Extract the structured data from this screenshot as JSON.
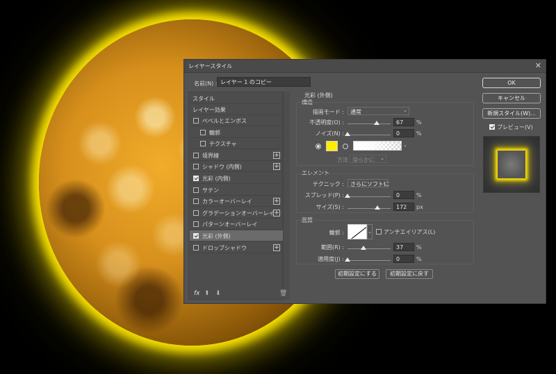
{
  "dialog": {
    "title": "レイヤースタイル",
    "close_glyph": "✕"
  },
  "name": {
    "label": "名前(N) :",
    "value": "レイヤー 1 のコピー"
  },
  "style_list": {
    "header_styles": "スタイル",
    "header_effects": "レイヤー効果",
    "items": [
      {
        "label": "ベベルとエンボス",
        "checked": false,
        "plus": false,
        "indent": false,
        "selected": false
      },
      {
        "label": "輪郭",
        "checked": false,
        "plus": false,
        "indent": true,
        "selected": false
      },
      {
        "label": "テクスチャ",
        "checked": false,
        "plus": false,
        "indent": true,
        "selected": false
      },
      {
        "label": "境界線",
        "checked": false,
        "plus": true,
        "indent": false,
        "selected": false
      },
      {
        "label": "シャドウ (内側)",
        "checked": false,
        "plus": true,
        "indent": false,
        "selected": false
      },
      {
        "label": "光彩 (内側)",
        "checked": true,
        "plus": false,
        "indent": false,
        "selected": false
      },
      {
        "label": "サテン",
        "checked": false,
        "plus": false,
        "indent": false,
        "selected": false
      },
      {
        "label": "カラーオーバーレイ",
        "checked": false,
        "plus": true,
        "indent": false,
        "selected": false
      },
      {
        "label": "グラデーションオーバーレイ",
        "checked": false,
        "plus": true,
        "indent": false,
        "selected": false
      },
      {
        "label": "パターンオーバーレイ",
        "checked": false,
        "plus": false,
        "indent": false,
        "selected": false
      },
      {
        "label": "光彩 (外側)",
        "checked": true,
        "plus": false,
        "indent": false,
        "selected": true
      },
      {
        "label": "ドロップシャドウ",
        "checked": false,
        "plus": true,
        "indent": false,
        "selected": false
      }
    ],
    "plus_glyph": "+",
    "fx_glyph": "fx",
    "up_glyph": "⬆",
    "down_glyph": "⬇",
    "trash_glyph": "🗑"
  },
  "outer_glow": {
    "title": "光彩 (外側)",
    "structure": {
      "title": "構造",
      "blend_label": "描画モード :",
      "blend_value": "通常",
      "opacity_label": "不透明度(O) :",
      "opacity_value": "67",
      "opacity": 67,
      "noise_label": "ノイズ(N) :",
      "noise_value": "0",
      "noise": 0,
      "unit": "%",
      "glow_color": "#ffec00",
      "method_label": "方法 :",
      "method_value": "滑らかに"
    },
    "elements": {
      "title": "エレメント",
      "technique_label": "テクニック :",
      "technique_value": "さらにソフトに",
      "spread_label": "スプレッド(P) :",
      "spread_value": "0",
      "spread": 0,
      "size_label": "サイズ(S) :",
      "size_value": "172",
      "size_fraction": 0.69,
      "unit_pct": "%",
      "unit_px": "px"
    },
    "quality": {
      "title": "画質",
      "contour_label": "輪郭 :",
      "antialias_label": "アンチエイリアス(L)",
      "antialias_checked": false,
      "range_label": "範囲(R) :",
      "range_value": "37",
      "range": 37,
      "jitter_label": "適用度(J) :",
      "jitter_value": "0",
      "jitter": 0,
      "unit": "%"
    },
    "make_default": "初期設定にする",
    "reset_default": "初期設定に戻す"
  },
  "right_panel": {
    "ok": "OK",
    "cancel": "キャンセル",
    "new_style": "新規スタイル(W)...",
    "preview_label": "プレビュー(V)",
    "preview_checked": true
  },
  "colors": {
    "glow": "#ffe400",
    "dialog_bg": "#535353"
  }
}
